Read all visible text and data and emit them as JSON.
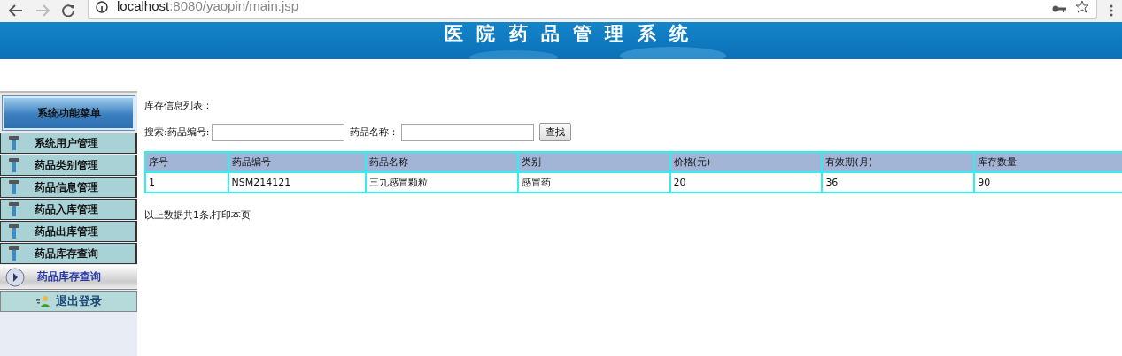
{
  "browser": {
    "address_host": "localhost",
    "address_path": ":8080/yaopin/main.jsp"
  },
  "banner": {
    "title": "医 院 药 品 管 理 系 统"
  },
  "sidebar": {
    "header": "系统功能菜单",
    "items": [
      {
        "label": "系统用户管理",
        "selected": false
      },
      {
        "label": "药品类别管理",
        "selected": false
      },
      {
        "label": "药品信息管理",
        "selected": false
      },
      {
        "label": "药品入库管理",
        "selected": false
      },
      {
        "label": "药品出库管理",
        "selected": false
      },
      {
        "label": "药品库存查询",
        "selected": false
      }
    ],
    "subitem": {
      "label": "药品库存查询",
      "selected": true
    },
    "logout": "退出登录"
  },
  "content": {
    "heading": "库存信息列表：",
    "search": {
      "code_label": "搜索:药品编号:",
      "name_label": "药品名称：",
      "button": "查找"
    },
    "table": {
      "columns": [
        "序号",
        "药品编号",
        "药品名称",
        "类别",
        "价格(元)",
        "有效期(月)",
        "库存数量"
      ],
      "rows": [
        [
          "1",
          "NSM214121",
          "三九感冒颗粒",
          "感冒药",
          "20",
          "36",
          "90"
        ]
      ]
    },
    "footer": "以上数据共1条,打印本页"
  }
}
